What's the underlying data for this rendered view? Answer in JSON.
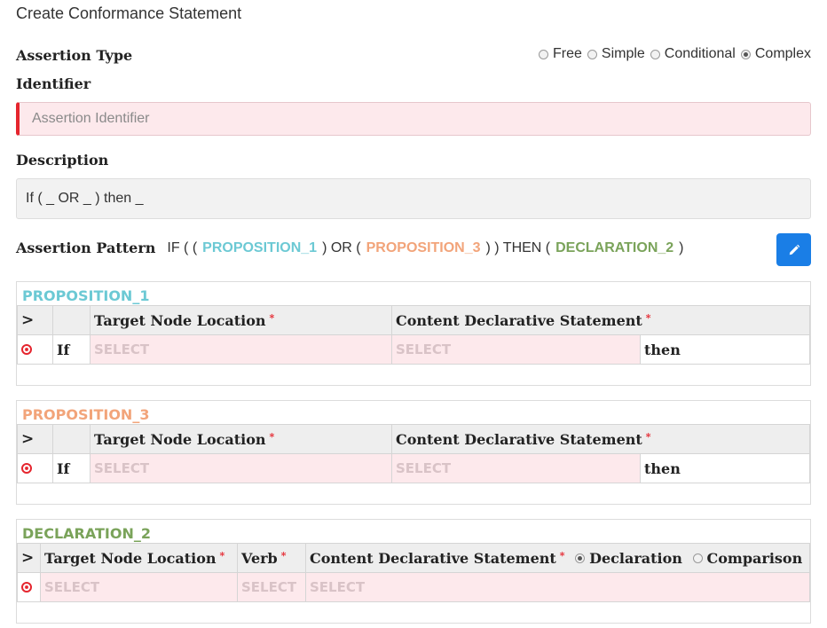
{
  "page_title": "Create Conformance Statement",
  "assertion_type": {
    "label": "Assertion Type",
    "options": [
      "Free",
      "Simple",
      "Conditional",
      "Complex"
    ],
    "selected": "Complex"
  },
  "identifier": {
    "label": "Identifier",
    "placeholder": "Assertion Identifier"
  },
  "description": {
    "label": "Description",
    "value": "If ( _ OR _ ) then _"
  },
  "pattern": {
    "label": "Assertion Pattern",
    "t1": "IF ( (",
    "p1": "PROPOSITION_1",
    "t2": ") OR (",
    "p3": "PROPOSITION_3",
    "t3": ") ) THEN (",
    "d2": "DECLARATION_2",
    "t4": ")",
    "colors": {
      "proposition_1": "#6cc9d4",
      "proposition_3": "#f2a47a",
      "declaration_2": "#7aa35a"
    }
  },
  "panels": {
    "p1": {
      "title": "PROPOSITION_1",
      "col_chevron": ">",
      "col_target": "Target Node Location",
      "col_content": "Content Declarative Statement",
      "req": "*",
      "row": {
        "kw_if": "If",
        "target": "SELECT",
        "content": "SELECT",
        "kw_then": "then"
      }
    },
    "p3": {
      "title": "PROPOSITION_3",
      "col_chevron": ">",
      "col_target": "Target Node Location",
      "col_content": "Content Declarative Statement",
      "req": "*",
      "row": {
        "kw_if": "If",
        "target": "SELECT",
        "content": "SELECT",
        "kw_then": "then"
      }
    },
    "d2": {
      "title": "DECLARATION_2",
      "col_chevron": ">",
      "col_target": "Target Node Location",
      "col_verb": "Verb",
      "col_content": "Content Declarative Statement",
      "req": "*",
      "opt_declaration": "Declaration",
      "opt_comparison": "Comparison",
      "selected": "Declaration",
      "row": {
        "target": "SELECT",
        "verb": "SELECT",
        "content": "SELECT"
      }
    }
  },
  "icons": {
    "edit": "pencil-icon",
    "delete": "delete-circle-icon",
    "expand": "chevron-right-icon"
  },
  "colors": {
    "accent": "#1a7ee6",
    "error": "#e5252e",
    "invalid_bg": "#fde9ec"
  }
}
